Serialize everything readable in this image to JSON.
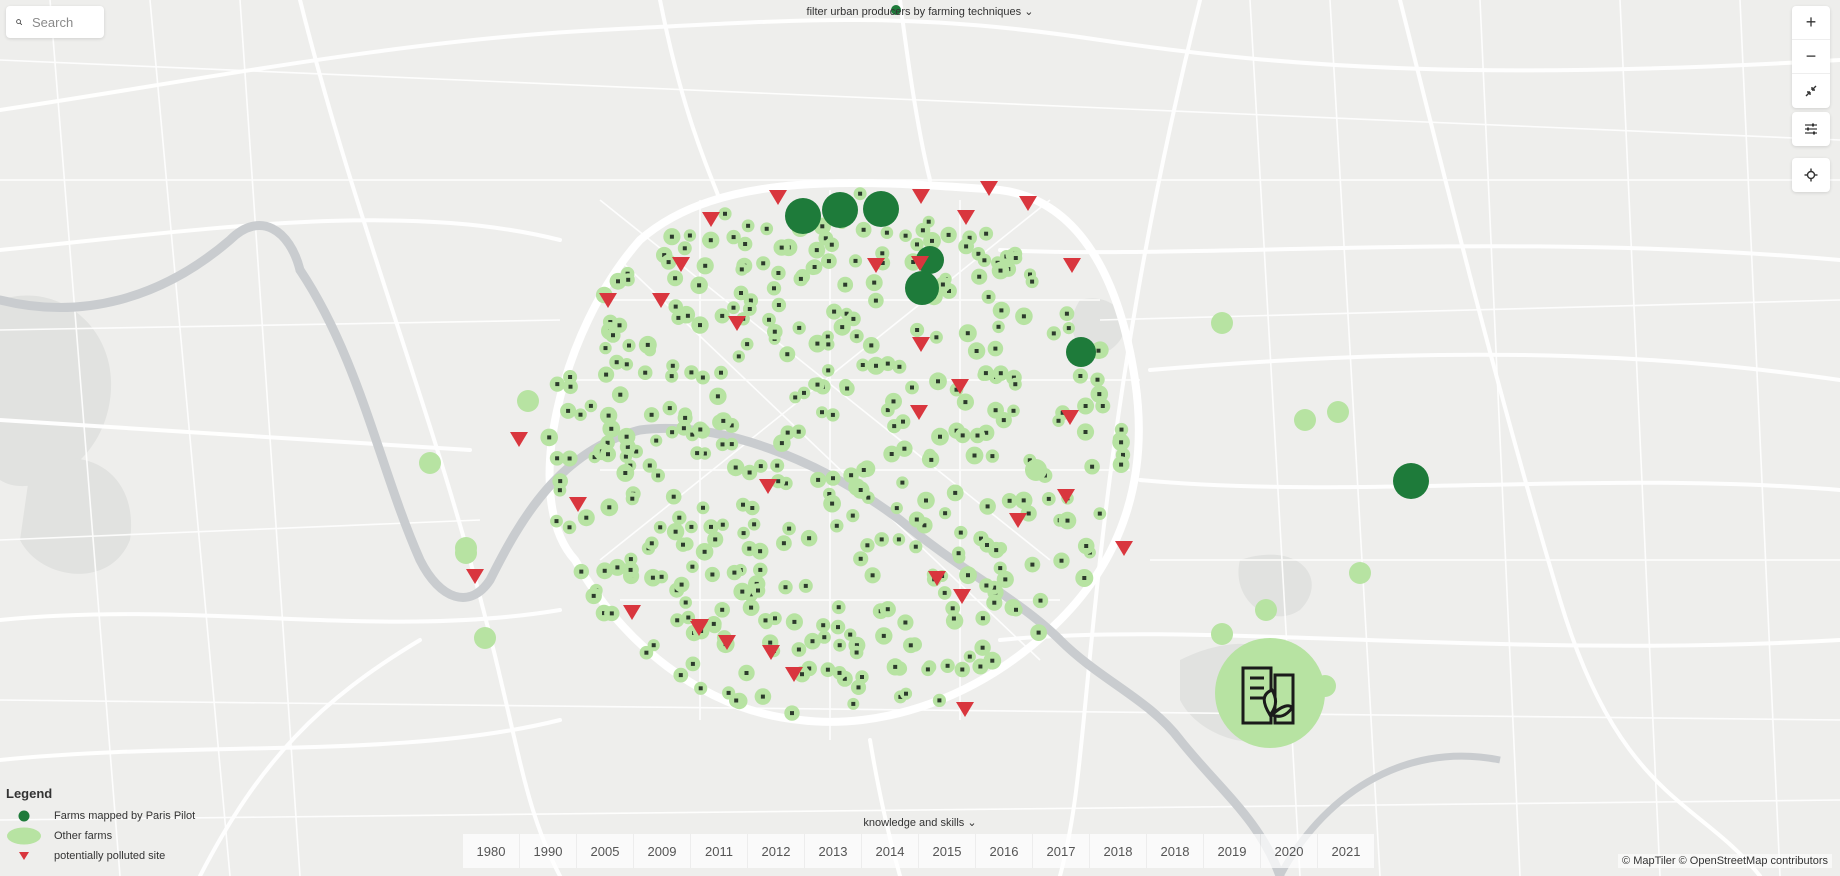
{
  "search": {
    "placeholder": "Search"
  },
  "filters": {
    "top_label": "filter urban producers by farming techniques",
    "bottom_label": "knowledge and skills"
  },
  "controls": {
    "zoom_in": "+",
    "zoom_out": "−"
  },
  "legend": {
    "title": "Legend",
    "items": [
      {
        "label": "Farms mapped by Paris Pilot",
        "color": "#1e7b3a"
      },
      {
        "label": "Other farms",
        "color": "#b7e3a2"
      },
      {
        "label": "potentially polluted site",
        "color": "#d9363e"
      }
    ]
  },
  "timeline": {
    "years": [
      "1980",
      "1990",
      "2005",
      "2009",
      "2011",
      "2012",
      "2013",
      "2014",
      "2015",
      "2016",
      "2017",
      "2018",
      "2018",
      "2019",
      "2020",
      "2021"
    ]
  },
  "attribution": "© MapTiler © OpenStreetMap contributors",
  "colors": {
    "land": "#eeeeec",
    "road": "#ffffff",
    "river": "#c9cccf",
    "farm_pilot": "#1e7b3a",
    "farm_other": "#b7e3a2",
    "polluted": "#d9363e"
  }
}
